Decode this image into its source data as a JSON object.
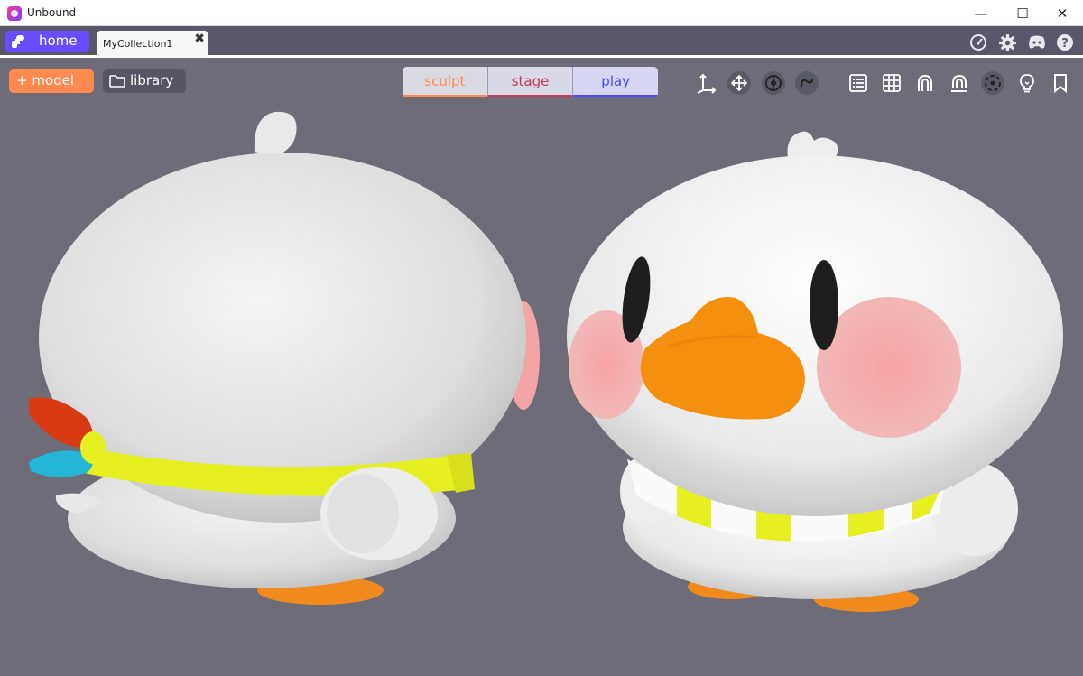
{
  "window": {
    "title": "Unbound",
    "minimize": "—",
    "maximize": "☐",
    "close": "✕"
  },
  "tabs": {
    "home_label": "home",
    "document_label": "MyCollection1",
    "close_symbol": "✖"
  },
  "top_right_icons": [
    "speedometer-icon",
    "gear-icon",
    "discord-icon",
    "help-icon"
  ],
  "toolbar": {
    "model_label": "+ model",
    "library_label": "library",
    "modes": [
      "sculpt",
      "stage",
      "play"
    ],
    "tools": [
      "gizmo-axes-icon",
      "move-icon",
      "symmetry-icon",
      "curve-icon",
      "list-icon",
      "grid-icon",
      "magnet-icon",
      "snap-icon",
      "camera-icon",
      "light-bulb-icon",
      "bookmark-icon"
    ]
  },
  "colors": {
    "accent_purple": "#6a4cff",
    "accent_orange": "#ff8a50",
    "stage_red": "#c23c5a",
    "play_blue": "#4d46ff",
    "viewport_bg": "#6e6c79",
    "tabbar_bg": "#595769"
  }
}
